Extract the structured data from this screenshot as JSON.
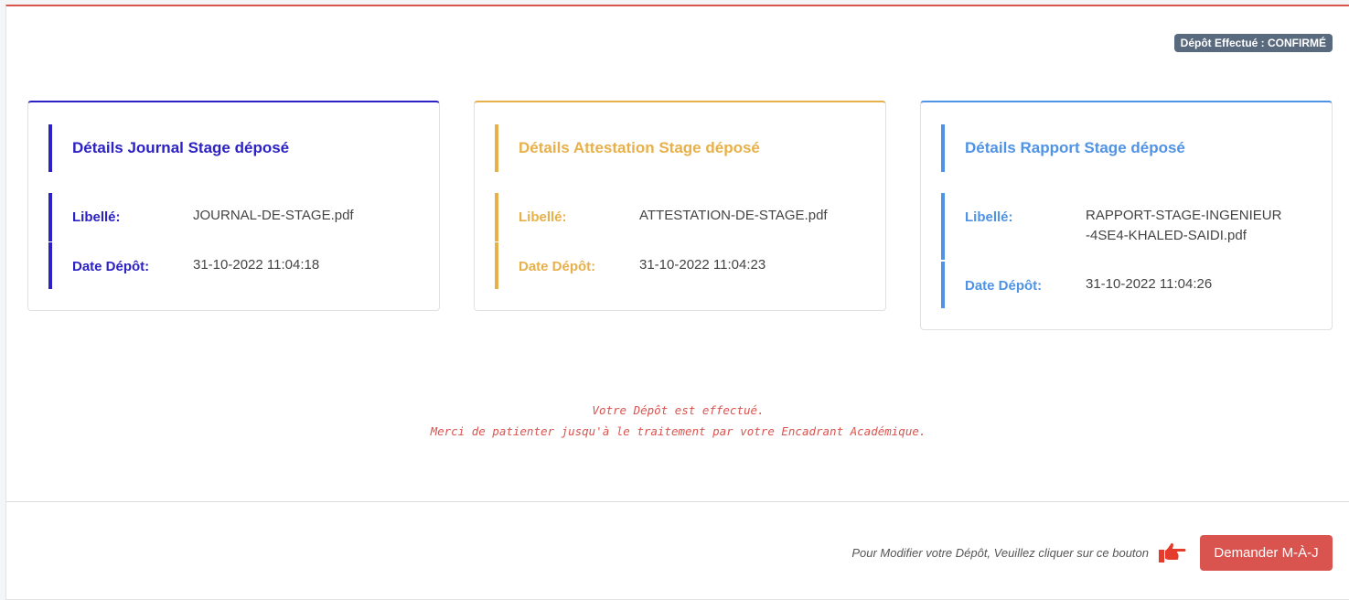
{
  "status_badge": "Dépôt Effectué : CONFIRMÉ",
  "cards": [
    {
      "title": "Détails Journal Stage déposé",
      "libelle_label": "Libellé:",
      "libelle_value": "JOURNAL-DE-STAGE.pdf",
      "date_label": "Date Dépôt:",
      "date_value": "31-10-2022 11:04:18",
      "color": "#2b21c4"
    },
    {
      "title": "Détails Attestation Stage déposé",
      "libelle_label": "Libellé:",
      "libelle_value": "ATTESTATION-DE-STAGE.pdf",
      "date_label": "Date Dépôt:",
      "date_value": "31-10-2022 11:04:23",
      "color": "#e8b04a"
    },
    {
      "title": "Détails Rapport Stage déposé",
      "libelle_label": "Libellé:",
      "libelle_value": "RAPPORT-STAGE-INGENIEUR-4SE4-KHALED-SAIDI.pdf",
      "date_label": "Date Dépôt:",
      "date_value": "31-10-2022 11:04:26",
      "color": "#4f93e6"
    }
  ],
  "message": {
    "line1": "Votre Dépôt est effectué.",
    "line2": "Merci de patienter jusqu'à le traitement par votre Encadrant Académique."
  },
  "footer": {
    "instruction": "Pour Modifier votre Dépôt, Veuillez cliquer sur ce bouton",
    "pointer_icon": "hand-pointing-right-icon",
    "button_label": "Demander M-À-J"
  },
  "colors": {
    "accent_red": "#d9534f",
    "badge_bg": "#5a6a7e"
  }
}
